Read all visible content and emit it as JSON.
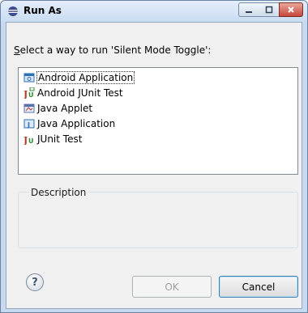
{
  "window": {
    "title": "Run As",
    "controls": {
      "minimize": "–",
      "maximize": "□",
      "close": "✕"
    }
  },
  "prompt": {
    "mnemonic": "S",
    "text": "elect a way to run 'Silent Mode Toggle':"
  },
  "launch_types": [
    {
      "label": "Android Application",
      "icon": "android-app-icon",
      "glyph": "▢",
      "color": "#2d6fb5",
      "selected": true
    },
    {
      "label": "Android JUnit Test",
      "icon": "android-junit-icon",
      "glyph": "Jᵁ",
      "color": "#2f8a2f",
      "selected": false
    },
    {
      "label": "Java Applet",
      "icon": "java-applet-icon",
      "glyph": "▣",
      "color": "#5b6fa8",
      "selected": false
    },
    {
      "label": "Java Application",
      "icon": "java-application-icon",
      "glyph": "J",
      "color": "#2d6fb5",
      "selected": false
    },
    {
      "label": "JUnit Test",
      "icon": "junit-icon",
      "glyph": "Jᴜ",
      "color": "#b03a2e",
      "selected": false
    }
  ],
  "description": {
    "label": "Description",
    "text": ""
  },
  "buttons": {
    "help": "?",
    "ok": "OK",
    "cancel": "Cancel",
    "ok_enabled": false
  }
}
